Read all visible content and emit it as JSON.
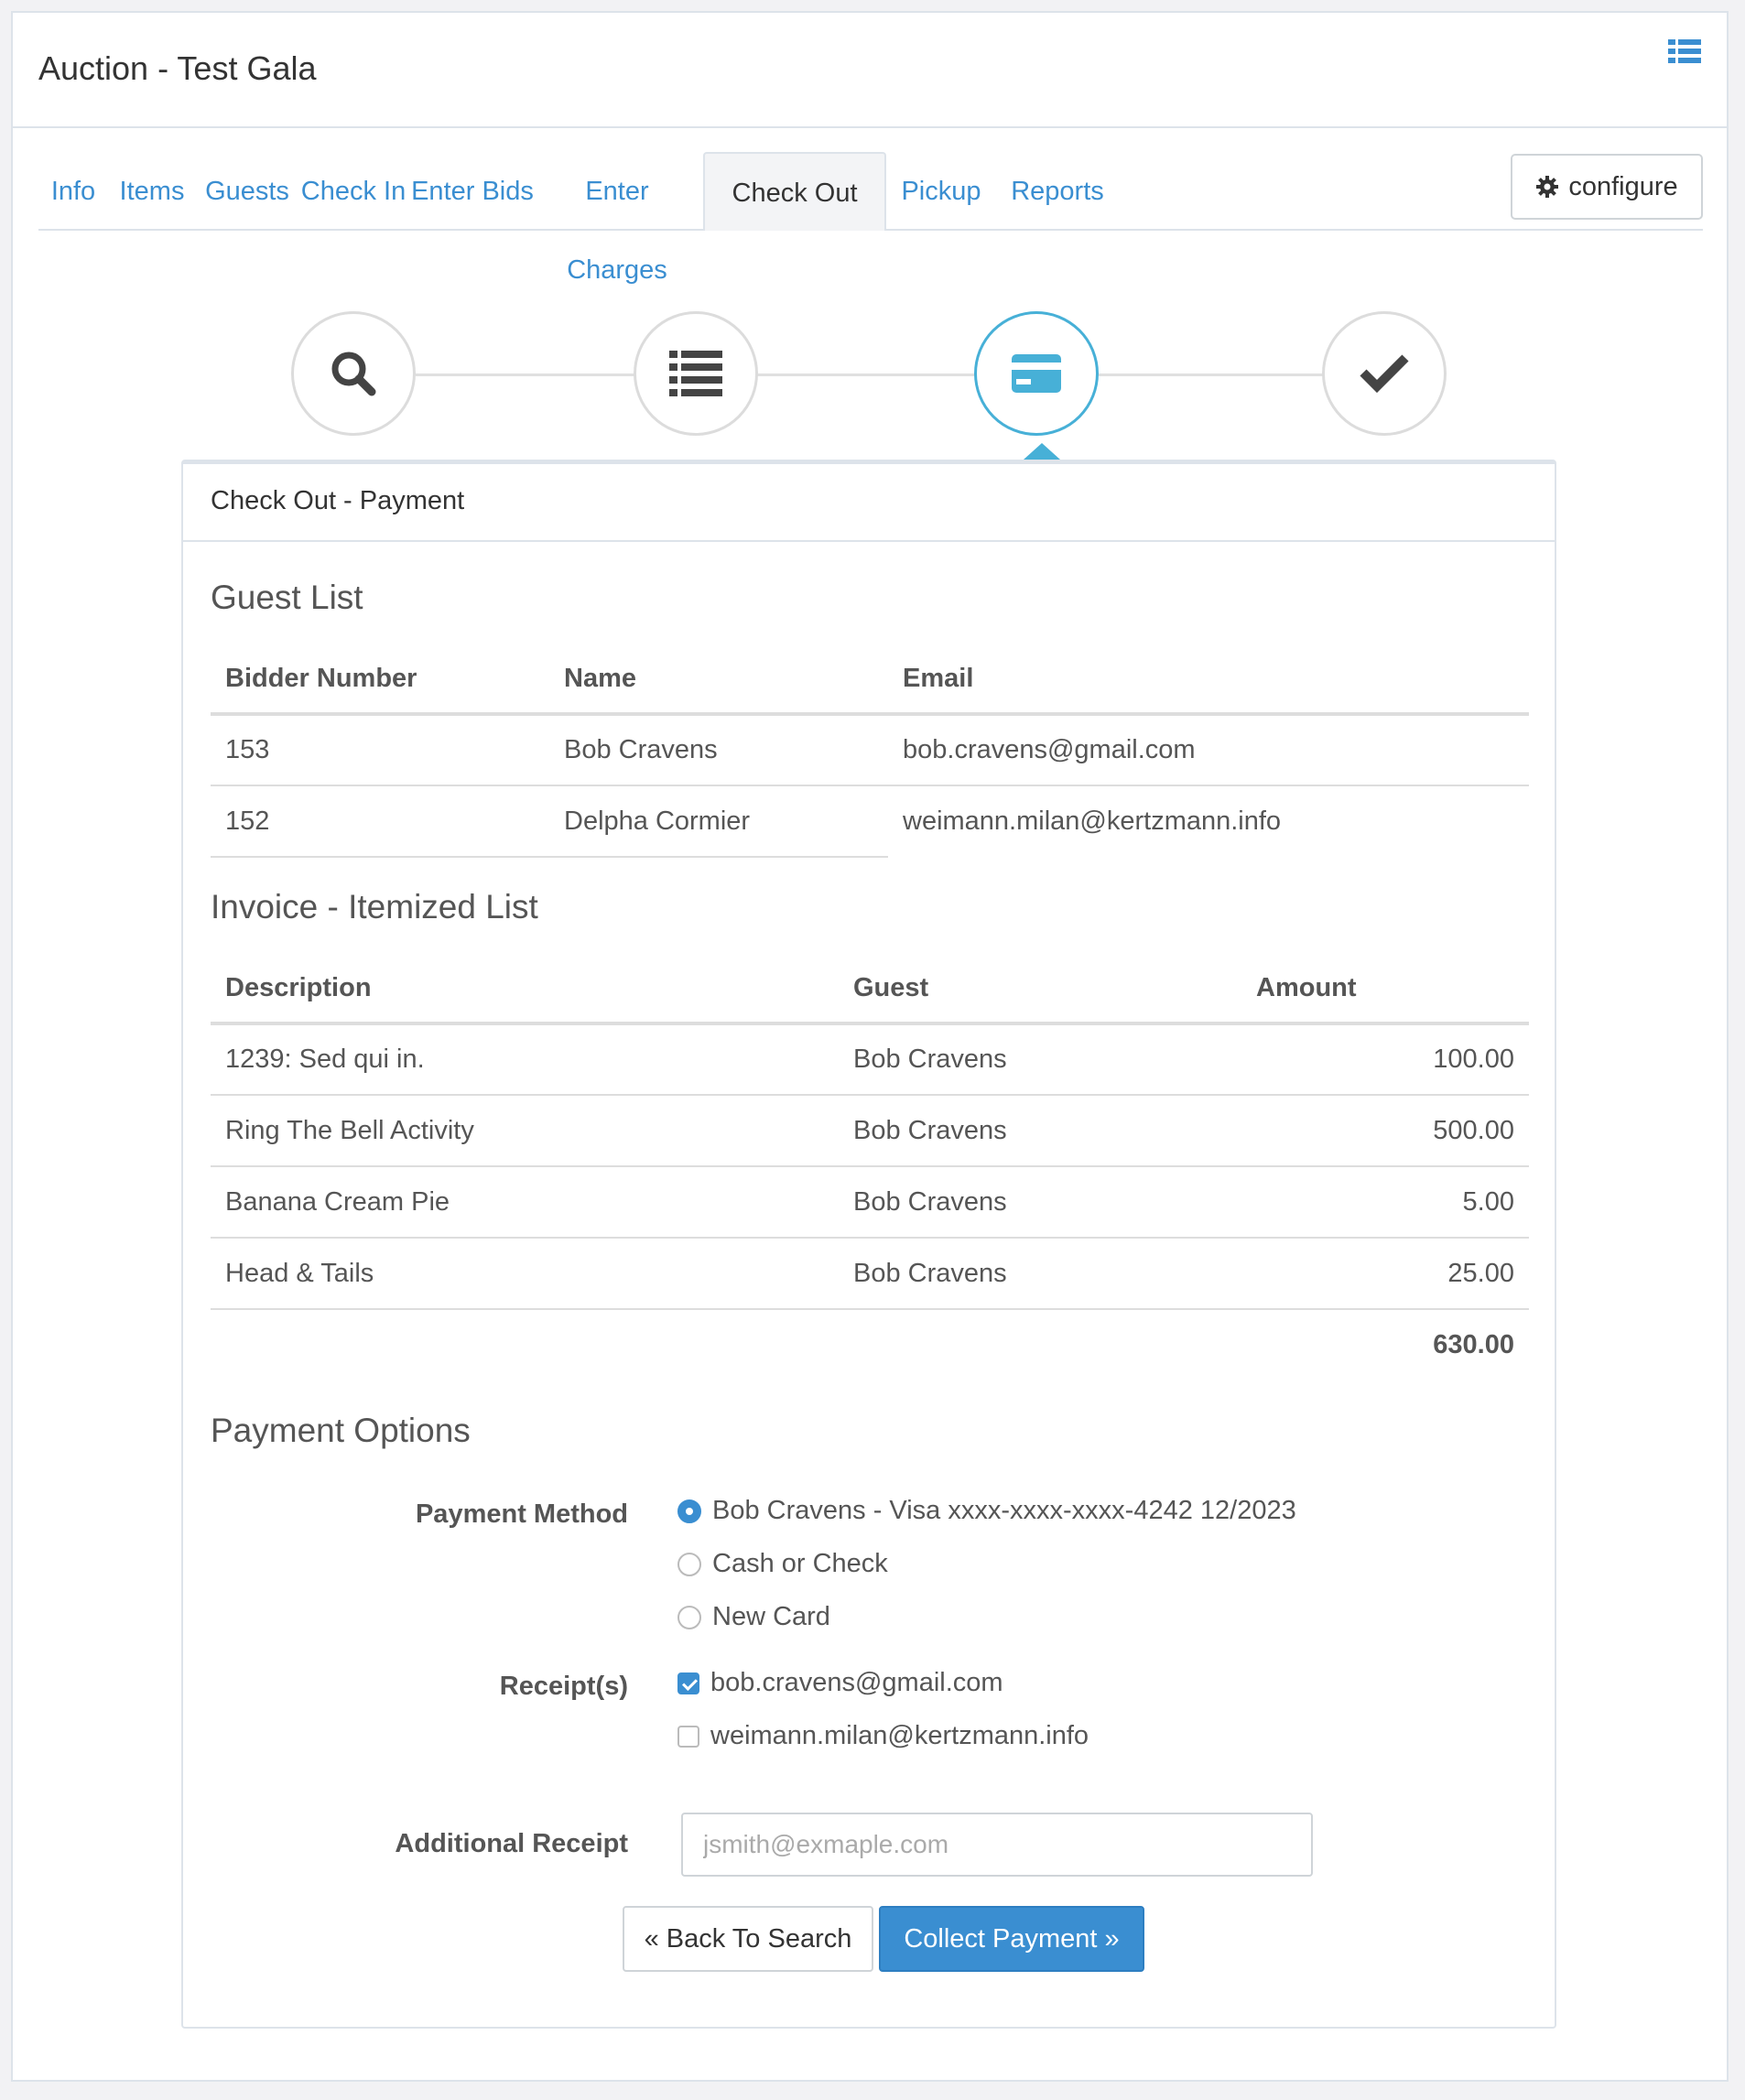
{
  "app": {
    "title": "Auction - Test Gala"
  },
  "tabs": [
    {
      "label": "Info"
    },
    {
      "label": "Items"
    },
    {
      "label": "Guests"
    },
    {
      "label": "Check In"
    },
    {
      "label": "Enter Bids"
    },
    {
      "label": "Enter Charges"
    },
    {
      "label": "Check Out",
      "active": true
    },
    {
      "label": "Pickup"
    },
    {
      "label": "Reports"
    }
  ],
  "configure_label": "configure",
  "steps": [
    {
      "icon": "search-icon"
    },
    {
      "icon": "list-icon"
    },
    {
      "icon": "credit-card-icon",
      "active": true
    },
    {
      "icon": "checkmark-icon"
    }
  ],
  "colors": {
    "accent": "#3a8ed1",
    "step_active": "#47b0d7"
  },
  "panel": {
    "title": "Check Out - Payment",
    "guest_list": {
      "title": "Guest List",
      "headers": [
        "Bidder Number",
        "Name",
        "Email"
      ],
      "rows": [
        [
          "153",
          "Bob Cravens",
          "bob.cravens@gmail.com"
        ],
        [
          "152",
          "Delpha Cormier",
          "weimann.milan@kertzmann.info"
        ]
      ]
    },
    "invoice": {
      "title": "Invoice - Itemized List",
      "headers": [
        "Description",
        "Guest",
        "Amount"
      ],
      "rows": [
        [
          "1239: Sed qui in.",
          "Bob Cravens",
          "100.00"
        ],
        [
          "Ring The Bell Activity",
          "Bob Cravens",
          "500.00"
        ],
        [
          "Banana Cream Pie",
          "Bob Cravens",
          "5.00"
        ],
        [
          "Head & Tails",
          "Bob Cravens",
          "25.00"
        ]
      ],
      "total": "630.00"
    },
    "payment": {
      "title": "Payment Options",
      "method_label": "Payment Method",
      "methods": [
        {
          "label": "Bob Cravens - Visa xxxx-xxxx-xxxx-4242 12/2023",
          "checked": true
        },
        {
          "label": "Cash or Check",
          "checked": false
        },
        {
          "label": "New Card",
          "checked": false
        }
      ],
      "receipts_label": "Receipt(s)",
      "receipts": [
        {
          "label": "bob.cravens@gmail.com",
          "checked": true
        },
        {
          "label": "weimann.milan@kertzmann.info",
          "checked": false
        }
      ],
      "additional_label": "Additional Receipt",
      "additional_placeholder": "jsmith@exmaple.com",
      "back_label": "« Back To Search",
      "collect_label": "Collect Payment »"
    }
  }
}
